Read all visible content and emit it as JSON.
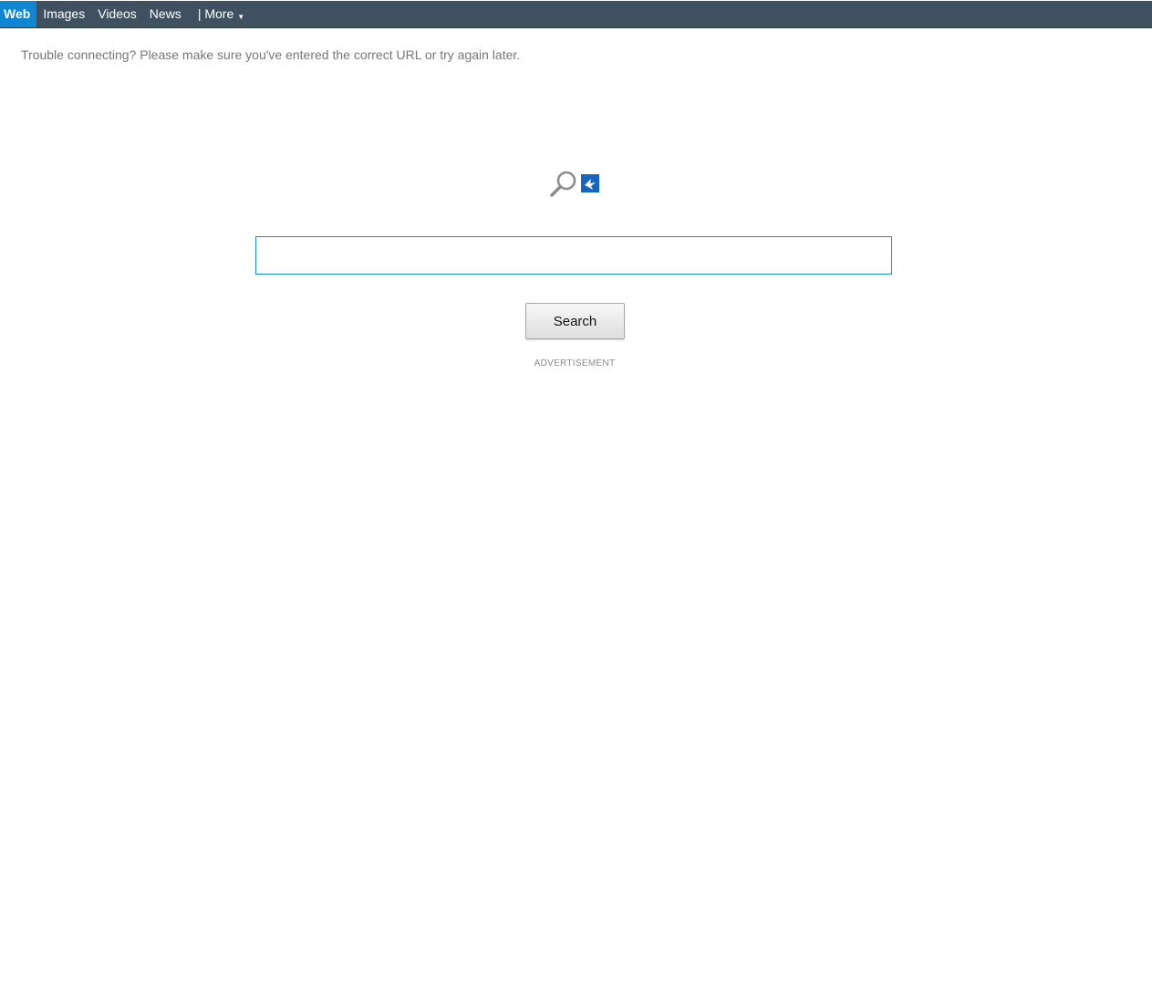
{
  "nav": {
    "items": [
      {
        "label": "Web",
        "active": true
      },
      {
        "label": "Images"
      },
      {
        "label": "Videos"
      },
      {
        "label": "News"
      }
    ],
    "more_label": "| More",
    "more_icon": "caret-down-icon"
  },
  "message": {
    "trouble": "Trouble connecting? Please make sure you've entered the correct URL or try again later."
  },
  "logo": {
    "icon": "magnifier-icon",
    "badge_icon": "bird-badge-icon"
  },
  "search": {
    "value": "",
    "placeholder": "",
    "button_label": "Search"
  },
  "ad": {
    "label": "ADVERTISEMENT"
  },
  "colors": {
    "topbar": "#3f5161",
    "active_tab": "#0f86d1",
    "input_border": "#1a8ccc",
    "badge": "#1565c0"
  }
}
